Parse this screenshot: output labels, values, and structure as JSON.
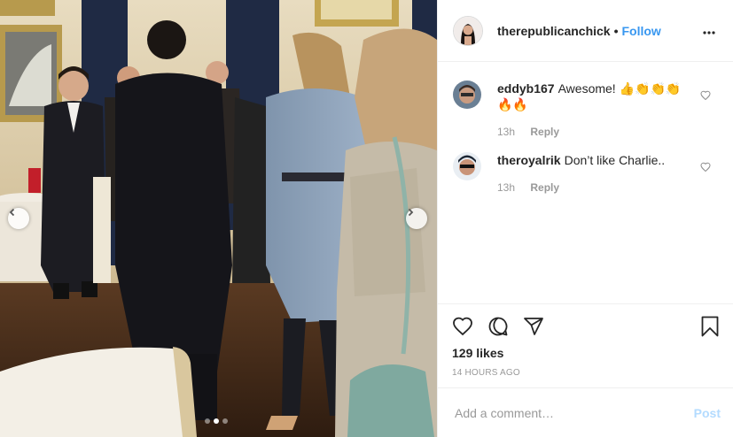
{
  "post": {
    "username": "therepublicanchick",
    "separator": "•",
    "follow_label": "Follow",
    "more_icon": "more-options-icon",
    "photo": {
      "description_icons": [
        "chevron-left-icon",
        "chevron-right-icon"
      ],
      "carousel": {
        "count": 3,
        "active": 1
      }
    }
  },
  "comments": [
    {
      "username": "eddyb167",
      "text": "Awesome! 👍👏👏👏🔥🔥",
      "time": "13h",
      "reply_label": "Reply"
    },
    {
      "username": "theroyalrik",
      "text": "Don’t like Charlie..",
      "time": "13h",
      "reply_label": "Reply"
    }
  ],
  "actions": {
    "icons": [
      "heart-icon",
      "comment-icon",
      "share-icon",
      "bookmark-icon"
    ],
    "likes": "129 likes",
    "time_ago": "14 HOURS AGO"
  },
  "add_comment": {
    "placeholder": "Add a comment…",
    "post_label": "Post"
  },
  "colors": {
    "accent": "#3897f0",
    "post_disabled": "#b3dbff",
    "muted": "#999999",
    "border": "#efefef"
  }
}
